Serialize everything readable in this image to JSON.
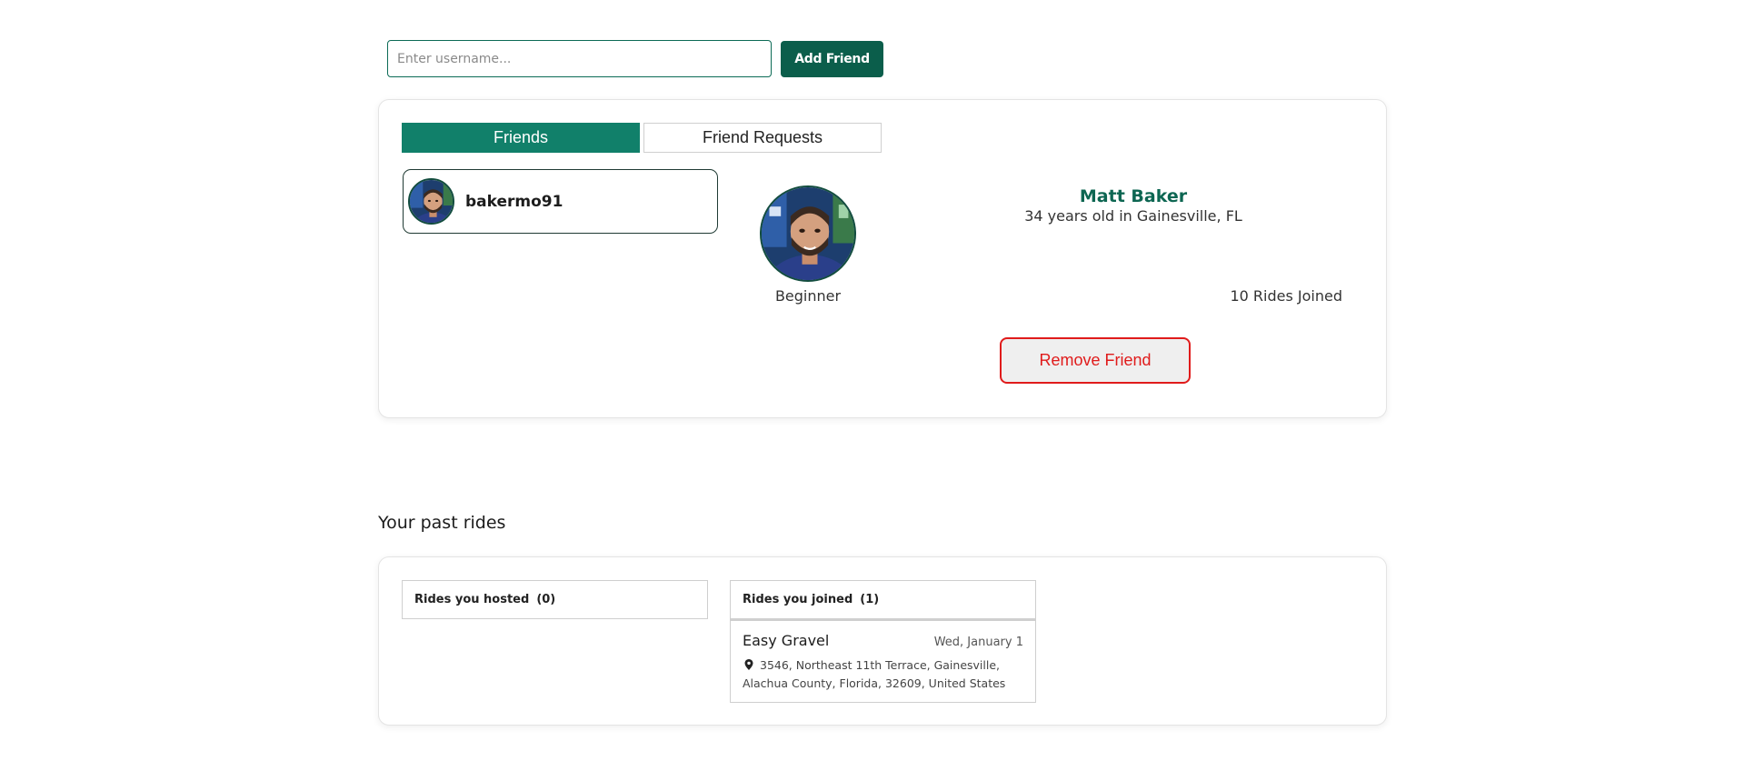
{
  "add_friend": {
    "placeholder": "Enter username...",
    "value": "",
    "button_label": "Add Friend"
  },
  "friends": {
    "tabs": [
      {
        "label": "Friends",
        "active": true
      },
      {
        "label": "Friend Requests",
        "active": false
      }
    ],
    "list": [
      {
        "username": "bakermo91"
      }
    ],
    "selected": {
      "name": "Matt Baker",
      "info": "34 years old in Gainesville, FL",
      "skill_level": "Beginner",
      "rides_joined": "10 Rides Joined",
      "remove_label": "Remove Friend"
    }
  },
  "past_rides": {
    "title": "Your past rides",
    "hosted": {
      "label": "Rides you hosted",
      "count": "(0)"
    },
    "joined": {
      "label": "Rides you joined",
      "count": "(1)",
      "rides": [
        {
          "name": "Easy Gravel",
          "date": "Wed, January 1",
          "address": "3546, Northeast 11th Terrace, Gainesville, Alachua County, Florida, 32609, United States"
        }
      ]
    }
  },
  "colors": {
    "brand": "#0b5e4b",
    "tab_active": "#11806a",
    "danger": "#e01b1b"
  },
  "icons": {
    "location": "map-pin-icon"
  }
}
